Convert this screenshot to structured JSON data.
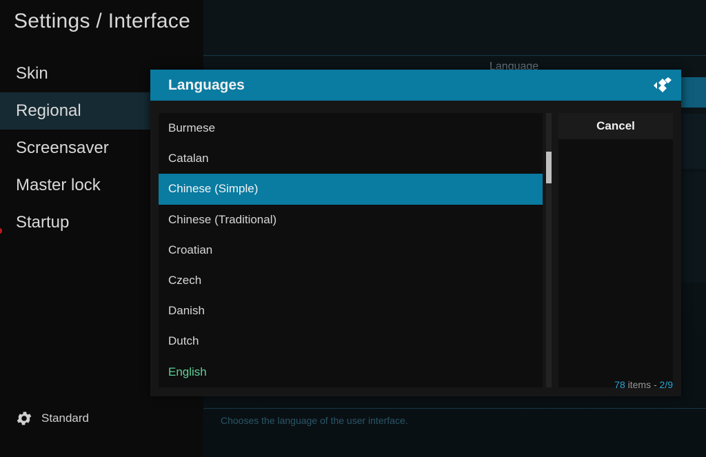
{
  "header": {
    "title": "Settings / Interface"
  },
  "sidebar": {
    "items": [
      {
        "label": "Skin"
      },
      {
        "label": "Regional",
        "active": true
      },
      {
        "label": "Screensaver"
      },
      {
        "label": "Master lock"
      },
      {
        "label": "Startup"
      }
    ],
    "settings_level": "Standard"
  },
  "background": {
    "setting_label": "Language",
    "description": "Chooses the language of the user interface."
  },
  "dialog": {
    "title": "Languages",
    "options": [
      {
        "label": "Burmese"
      },
      {
        "label": "Catalan"
      },
      {
        "label": "Chinese (Simple)",
        "selected": true
      },
      {
        "label": "Chinese (Traditional)"
      },
      {
        "label": "Croatian"
      },
      {
        "label": "Czech"
      },
      {
        "label": "Danish"
      },
      {
        "label": "Dutch"
      },
      {
        "label": "English",
        "current": true
      }
    ],
    "cancel_label": "Cancel",
    "item_count": "78",
    "item_count_suffix": " items - ",
    "page": "2/9"
  },
  "colors": {
    "accent": "#0a7ba1",
    "current_item": "#5fd09a",
    "count_accent": "#2aa6d6"
  },
  "icons": {
    "logo": "kodi-logo-icon",
    "settings_level": "gear-icon"
  }
}
